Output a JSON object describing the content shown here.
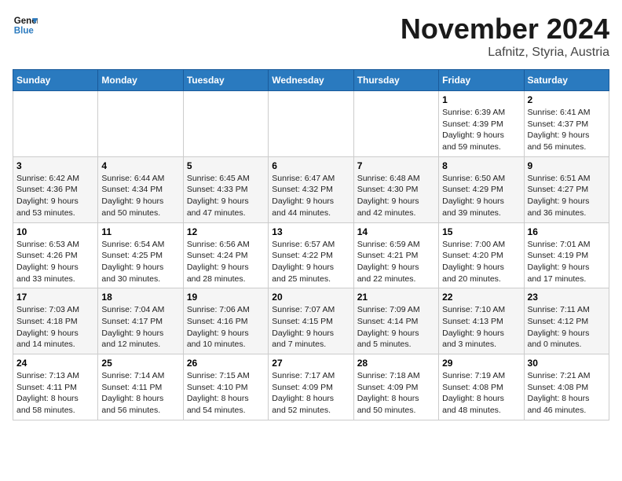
{
  "header": {
    "logo_line1": "General",
    "logo_line2": "Blue",
    "month": "November 2024",
    "location": "Lafnitz, Styria, Austria"
  },
  "weekdays": [
    "Sunday",
    "Monday",
    "Tuesday",
    "Wednesday",
    "Thursday",
    "Friday",
    "Saturday"
  ],
  "weeks": [
    [
      {
        "day": "",
        "info": ""
      },
      {
        "day": "",
        "info": ""
      },
      {
        "day": "",
        "info": ""
      },
      {
        "day": "",
        "info": ""
      },
      {
        "day": "",
        "info": ""
      },
      {
        "day": "1",
        "info": "Sunrise: 6:39 AM\nSunset: 4:39 PM\nDaylight: 9 hours\nand 59 minutes."
      },
      {
        "day": "2",
        "info": "Sunrise: 6:41 AM\nSunset: 4:37 PM\nDaylight: 9 hours\nand 56 minutes."
      }
    ],
    [
      {
        "day": "3",
        "info": "Sunrise: 6:42 AM\nSunset: 4:36 PM\nDaylight: 9 hours\nand 53 minutes."
      },
      {
        "day": "4",
        "info": "Sunrise: 6:44 AM\nSunset: 4:34 PM\nDaylight: 9 hours\nand 50 minutes."
      },
      {
        "day": "5",
        "info": "Sunrise: 6:45 AM\nSunset: 4:33 PM\nDaylight: 9 hours\nand 47 minutes."
      },
      {
        "day": "6",
        "info": "Sunrise: 6:47 AM\nSunset: 4:32 PM\nDaylight: 9 hours\nand 44 minutes."
      },
      {
        "day": "7",
        "info": "Sunrise: 6:48 AM\nSunset: 4:30 PM\nDaylight: 9 hours\nand 42 minutes."
      },
      {
        "day": "8",
        "info": "Sunrise: 6:50 AM\nSunset: 4:29 PM\nDaylight: 9 hours\nand 39 minutes."
      },
      {
        "day": "9",
        "info": "Sunrise: 6:51 AM\nSunset: 4:27 PM\nDaylight: 9 hours\nand 36 minutes."
      }
    ],
    [
      {
        "day": "10",
        "info": "Sunrise: 6:53 AM\nSunset: 4:26 PM\nDaylight: 9 hours\nand 33 minutes."
      },
      {
        "day": "11",
        "info": "Sunrise: 6:54 AM\nSunset: 4:25 PM\nDaylight: 9 hours\nand 30 minutes."
      },
      {
        "day": "12",
        "info": "Sunrise: 6:56 AM\nSunset: 4:24 PM\nDaylight: 9 hours\nand 28 minutes."
      },
      {
        "day": "13",
        "info": "Sunrise: 6:57 AM\nSunset: 4:22 PM\nDaylight: 9 hours\nand 25 minutes."
      },
      {
        "day": "14",
        "info": "Sunrise: 6:59 AM\nSunset: 4:21 PM\nDaylight: 9 hours\nand 22 minutes."
      },
      {
        "day": "15",
        "info": "Sunrise: 7:00 AM\nSunset: 4:20 PM\nDaylight: 9 hours\nand 20 minutes."
      },
      {
        "day": "16",
        "info": "Sunrise: 7:01 AM\nSunset: 4:19 PM\nDaylight: 9 hours\nand 17 minutes."
      }
    ],
    [
      {
        "day": "17",
        "info": "Sunrise: 7:03 AM\nSunset: 4:18 PM\nDaylight: 9 hours\nand 14 minutes."
      },
      {
        "day": "18",
        "info": "Sunrise: 7:04 AM\nSunset: 4:17 PM\nDaylight: 9 hours\nand 12 minutes."
      },
      {
        "day": "19",
        "info": "Sunrise: 7:06 AM\nSunset: 4:16 PM\nDaylight: 9 hours\nand 10 minutes."
      },
      {
        "day": "20",
        "info": "Sunrise: 7:07 AM\nSunset: 4:15 PM\nDaylight: 9 hours\nand 7 minutes."
      },
      {
        "day": "21",
        "info": "Sunrise: 7:09 AM\nSunset: 4:14 PM\nDaylight: 9 hours\nand 5 minutes."
      },
      {
        "day": "22",
        "info": "Sunrise: 7:10 AM\nSunset: 4:13 PM\nDaylight: 9 hours\nand 3 minutes."
      },
      {
        "day": "23",
        "info": "Sunrise: 7:11 AM\nSunset: 4:12 PM\nDaylight: 9 hours\nand 0 minutes."
      }
    ],
    [
      {
        "day": "24",
        "info": "Sunrise: 7:13 AM\nSunset: 4:11 PM\nDaylight: 8 hours\nand 58 minutes."
      },
      {
        "day": "25",
        "info": "Sunrise: 7:14 AM\nSunset: 4:11 PM\nDaylight: 8 hours\nand 56 minutes."
      },
      {
        "day": "26",
        "info": "Sunrise: 7:15 AM\nSunset: 4:10 PM\nDaylight: 8 hours\nand 54 minutes."
      },
      {
        "day": "27",
        "info": "Sunrise: 7:17 AM\nSunset: 4:09 PM\nDaylight: 8 hours\nand 52 minutes."
      },
      {
        "day": "28",
        "info": "Sunrise: 7:18 AM\nSunset: 4:09 PM\nDaylight: 8 hours\nand 50 minutes."
      },
      {
        "day": "29",
        "info": "Sunrise: 7:19 AM\nSunset: 4:08 PM\nDaylight: 8 hours\nand 48 minutes."
      },
      {
        "day": "30",
        "info": "Sunrise: 7:21 AM\nSunset: 4:08 PM\nDaylight: 8 hours\nand 46 minutes."
      }
    ]
  ]
}
